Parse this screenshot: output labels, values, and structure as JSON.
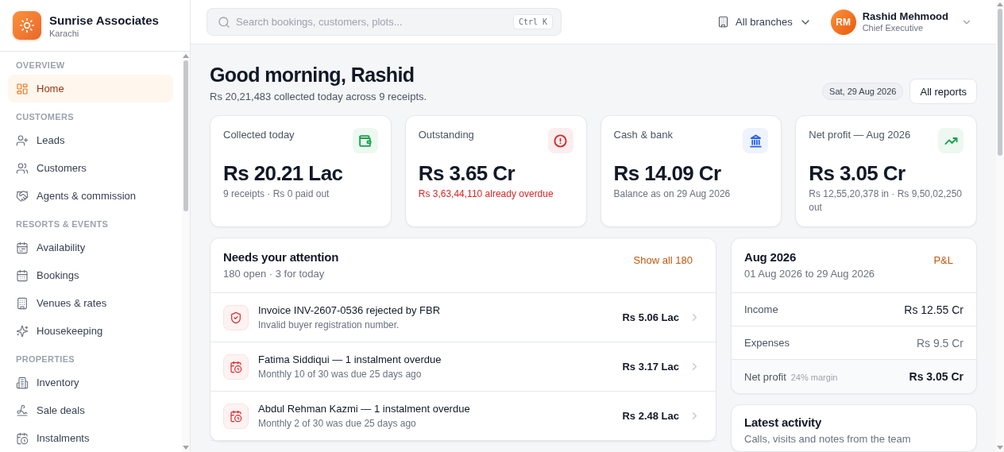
{
  "brand": {
    "name": "Sunrise Associates",
    "location": "Karachi"
  },
  "sidebar": {
    "sections": [
      {
        "title": "OVERVIEW",
        "items": [
          {
            "label": "Home",
            "kind": "dashboard",
            "selected": true
          }
        ]
      },
      {
        "title": "CUSTOMERS",
        "items": [
          {
            "label": "Leads",
            "kind": "leads",
            "selected": false
          },
          {
            "label": "Customers",
            "kind": "customers",
            "selected": false
          },
          {
            "label": "Agents & commission",
            "kind": "agents",
            "selected": false
          }
        ]
      },
      {
        "title": "RESORTS & EVENTS",
        "items": [
          {
            "label": "Availability",
            "kind": "availability",
            "selected": false
          },
          {
            "label": "Bookings",
            "kind": "bookings",
            "selected": false
          },
          {
            "label": "Venues & rates",
            "kind": "venues",
            "selected": false
          },
          {
            "label": "Housekeeping",
            "kind": "housekeeping",
            "selected": false
          }
        ]
      },
      {
        "title": "PROPERTIES",
        "items": [
          {
            "label": "Inventory",
            "kind": "inventory",
            "selected": false
          },
          {
            "label": "Sale deals",
            "kind": "deals",
            "selected": false
          },
          {
            "label": "Instalments",
            "kind": "instalments",
            "selected": false
          }
        ]
      }
    ]
  },
  "search": {
    "placeholder": "Search bookings, customers, plots...",
    "shortcut": "Ctrl K"
  },
  "branch_picker": {
    "label": "All branches"
  },
  "user": {
    "initials": "RM",
    "name": "Rashid Mehmood",
    "role": "Chief Executive"
  },
  "greeting": {
    "title": "Good morning, Rashid",
    "subtitle": "Rs 20,21,483 collected today across 9 receipts."
  },
  "date_chip": "Sat, 29 Aug 2026",
  "reports_button": "All reports",
  "kpis": [
    {
      "label": "Collected today",
      "value": "Rs 20.21 Lac",
      "note": "9 receipts · Rs 0 paid out",
      "kind": "wallet",
      "color": "#16a34a",
      "alert": false
    },
    {
      "label": "Outstanding",
      "value": "Rs 3.65 Cr",
      "note": "Rs 3,63,44,110 already overdue",
      "kind": "alert",
      "color": "#dc2626",
      "alert": true
    },
    {
      "label": "Cash & bank",
      "value": "Rs 14.09 Cr",
      "note": "Balance as on 29 Aug 2026",
      "kind": "bank",
      "color": "#2563eb",
      "alert": false
    },
    {
      "label": "Net profit — Aug 2026",
      "value": "Rs 3.05 Cr",
      "note": "Rs 12,55,20,378 in · Rs 9,50,02,250 out",
      "kind": "trend",
      "color": "#16a34a",
      "alert": false
    }
  ],
  "attention": {
    "title": "Needs your attention",
    "subtitle": "180 open · 3 for today",
    "link": "Show all 180",
    "items": [
      {
        "kind": "invoice",
        "title": "Invoice INV-2607-0536 rejected by FBR",
        "detail": "Invalid buyer registration number.",
        "amount": "Rs 5.06 Lac"
      },
      {
        "kind": "instalment",
        "title": "Fatima Siddiqui — 1 instalment overdue",
        "detail": "Monthly 10 of 30 was due 25 days ago",
        "amount": "Rs 3.17 Lac"
      },
      {
        "kind": "instalment",
        "title": "Abdul Rehman Kazmi — 1 instalment overdue",
        "detail": "Monthly 2 of 30 was due 25 days ago",
        "amount": "Rs 2.48 Lac"
      }
    ]
  },
  "pnl": {
    "title": "Aug 2026",
    "subtitle": "01 Aug 2026 to 29 Aug 2026",
    "link": "P&L",
    "rows": [
      {
        "kind": "income",
        "label": "Income",
        "value": "Rs 12.55 Cr"
      },
      {
        "kind": "expense",
        "label": "Expenses",
        "value": "Rs 9.5 Cr"
      },
      {
        "kind": "net",
        "label": "Net profit",
        "note": "24% margin",
        "value": "Rs 3.05 Cr"
      }
    ]
  },
  "activity": {
    "title": "Latest activity",
    "subtitle": "Calls, visits and notes from the team"
  }
}
